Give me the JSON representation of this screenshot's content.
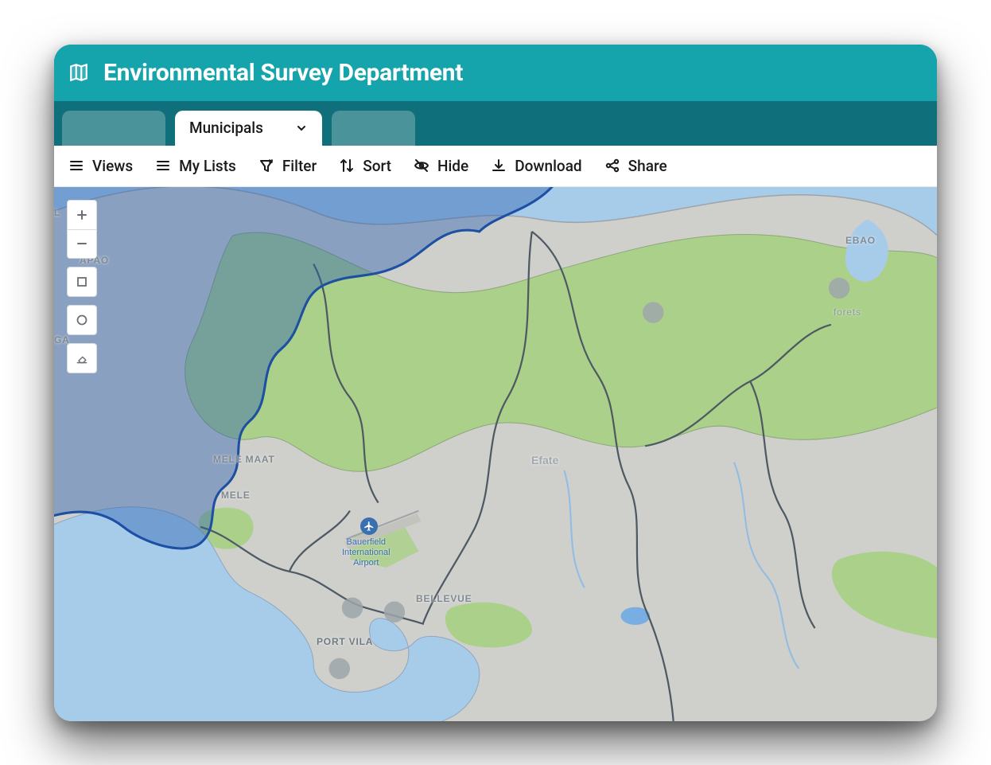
{
  "header": {
    "title": "Environmental Survey Department"
  },
  "tabs": {
    "active_label": "Municipals"
  },
  "toolbar": {
    "views": "Views",
    "mylists": "My Lists",
    "filter": "Filter",
    "sort": "Sort",
    "hide": "Hide",
    "download": "Download",
    "share": "Share"
  },
  "map": {
    "labels": {
      "apao": "APAO",
      "mele_maat": "MELE MAAT",
      "mele": "MELE",
      "bellevue": "BELLEVUE",
      "port_vila": "PORT VILA",
      "efate": "Efate",
      "ebao": "EBAO",
      "forets": "forets",
      "airport": "Bauerfield\nInternational\nAirport",
      "ga": "GA",
      "l": "L"
    },
    "selected_overlay": "northwest-ocean-polygon"
  }
}
